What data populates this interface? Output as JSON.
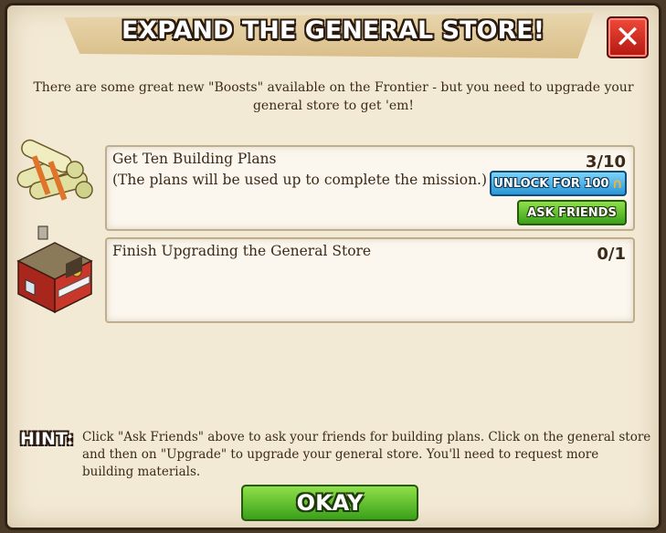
{
  "dialog": {
    "title": "EXPAND THE GENERAL STORE!",
    "close_symbol": "✕",
    "intro": "There are some great new \"Boosts\" available on the Frontier - but you need to upgrade your general store to get 'em!"
  },
  "tasks": [
    {
      "icon": "building-plans-icon",
      "line1": "Get Ten Building Plans",
      "line2": "(The plans will be used up to complete the mission.)",
      "count": "3/10",
      "progress": 0.3,
      "unlock_label": "UNLOCK FOR 100",
      "unlock_currency_icon": "horseshoe-icon",
      "ask_label": "ASK FRIENDS"
    },
    {
      "icon": "general-store-icon",
      "line1": "Finish Upgrading the General Store",
      "count": "0/1",
      "progress": 0
    }
  ],
  "hint": {
    "label": "HINT:",
    "text": "Click \"Ask Friends\" above to ask your friends for building plans. Click on the general store and then on \"Upgrade\" to upgrade your general store. You'll need to request more building materials."
  },
  "footer": {
    "okay_label": "OKAY"
  },
  "colors": {
    "parchment": "#f3ead6",
    "close_red": "#d8281c",
    "unlock_blue": "#2a96d6",
    "action_green": "#3aa01a"
  }
}
